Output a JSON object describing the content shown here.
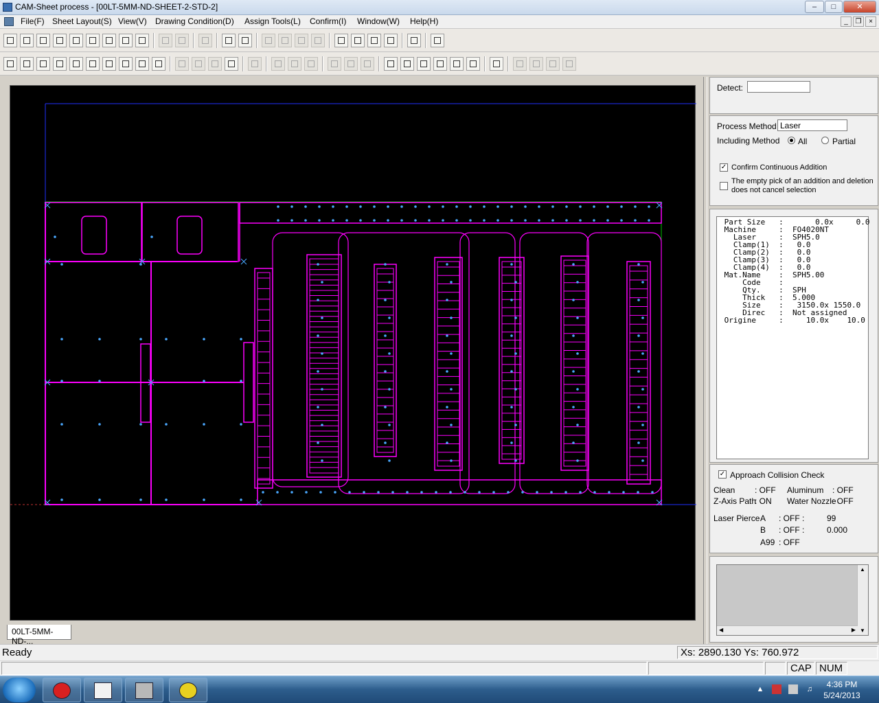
{
  "window": {
    "title": "CAM-Sheet process - [00LT-5MM-ND-SHEET-2-STD-2]"
  },
  "menu": [
    "File(F)",
    "Sheet Layout(S)",
    "View(V)",
    "Drawing Condition(D)",
    "Assign Tools(L)",
    "Confirm(I)",
    "Window(W)",
    "Help(H)"
  ],
  "toolbar1_icons": [
    "new-icon",
    "open-icon",
    "nest-icon",
    "save-folder-icon",
    "save-icon",
    "copy-sheet-icon",
    "settings-sheet-icon",
    "sheet-edit-icon",
    "spec-icon",
    "undo-icon",
    "redo-icon",
    "print-icon",
    "run-icon",
    "grid-icon",
    "auto1-icon",
    "auto2-icon",
    "auto3-icon",
    "auto4-icon",
    "info1-icon",
    "info2-icon",
    "info3-icon",
    "info4-icon",
    "whatsthis-help-icon",
    "nc-output-icon"
  ],
  "toolbar2_icons": [
    "fit-window-icon",
    "zoom-area-icon",
    "zoom-window-icon",
    "zoom-in-icon",
    "zoom-out-icon",
    "zoom-fit-icon",
    "zoom-part-icon",
    "view-split-v-icon",
    "view-split-h-icon",
    "view-cascade-icon",
    "tool-a-icon",
    "tool-b-icon",
    "tool-c-icon",
    "tool-d-icon",
    "tool-e-icon",
    "tool-f-icon",
    "tool-g-icon",
    "tool-h-icon",
    "tool-i-icon",
    "tool-j-icon",
    "tool-k-icon",
    "select1-icon",
    "select2-icon",
    "select3-icon",
    "select4-icon",
    "select5-icon",
    "delete-icon",
    "sort-icon",
    "array1-icon",
    "array2-icon",
    "array3-icon",
    "array4-icon"
  ],
  "canvas": {
    "tab_label": "00LT-5MM-ND-...",
    "background": "#000000",
    "part_color": "#ff00ff",
    "sheet_color": "#00c000",
    "frame_color": "#2030ff"
  },
  "detect": {
    "label": "Detect:",
    "value": ""
  },
  "process": {
    "method_label": "Process Method",
    "method_value": "Laser",
    "including_label": "Including Method",
    "opt_all": "All",
    "opt_partial": "Partial",
    "selected": "All"
  },
  "checks": {
    "confirm_addition": "Confirm Continuous Addition",
    "confirm_addition_checked": true,
    "empty_pick_line1": "The empty pick of an addition and deletion",
    "empty_pick_line2": "does not cancel selection",
    "empty_pick_checked": false
  },
  "info": [
    {
      "k": "Part Size",
      "v": "     0.0x     0.0"
    },
    {
      "k": "Machine",
      "v": "FO4020NT"
    },
    {
      "k": "  Laser",
      "v": "SPH5.0"
    },
    {
      "k": "  Clamp(1)",
      "v": " 0.0"
    },
    {
      "k": "  Clamp(2)",
      "v": " 0.0"
    },
    {
      "k": "  Clamp(3)",
      "v": " 0.0"
    },
    {
      "k": "  Clamp(4)",
      "v": " 0.0"
    },
    {
      "k": "Mat.Name",
      "v": "SPH5.00"
    },
    {
      "k": "    Code",
      "v": ""
    },
    {
      "k": "    Qty.",
      "v": "SPH"
    },
    {
      "k": "    Thick",
      "v": "5.000"
    },
    {
      "k": "    Size",
      "v": " 3150.0x 1550.0"
    },
    {
      "k": "    Direc",
      "v": "Not assigned"
    },
    {
      "k": "Origine",
      "v": "   10.0x    10.0"
    }
  ],
  "collision": {
    "label": "Approach Collision Check",
    "checked": true,
    "clean_label": "Clean",
    "clean_value": ":  OFF",
    "aluminum_label": "Aluminum",
    "aluminum_value": ":  OFF",
    "zaxis_label": "Z-Axis Path",
    "zaxis_value": ":  ON",
    "water_label": "Water Nozzle",
    "water_value": ":  OFF",
    "pierce_label": "Laser Pierce",
    "pierce_a": "A",
    "pierce_a_value": ":    OFF    :",
    "pierce_a_num": "99",
    "pierce_b": "B",
    "pierce_b_value": ":    OFF    :",
    "pierce_b_num": "0.000",
    "pierce_a99": "A99",
    "pierce_a99_value": ":    OFF"
  },
  "status": {
    "ready": "Ready",
    "coords": "Xs:  2890.130 Ys:   760.972",
    "cap": "CAP",
    "num": "NUM"
  },
  "clock": {
    "time": "4:36 PM",
    "date": "5/24/2013"
  }
}
